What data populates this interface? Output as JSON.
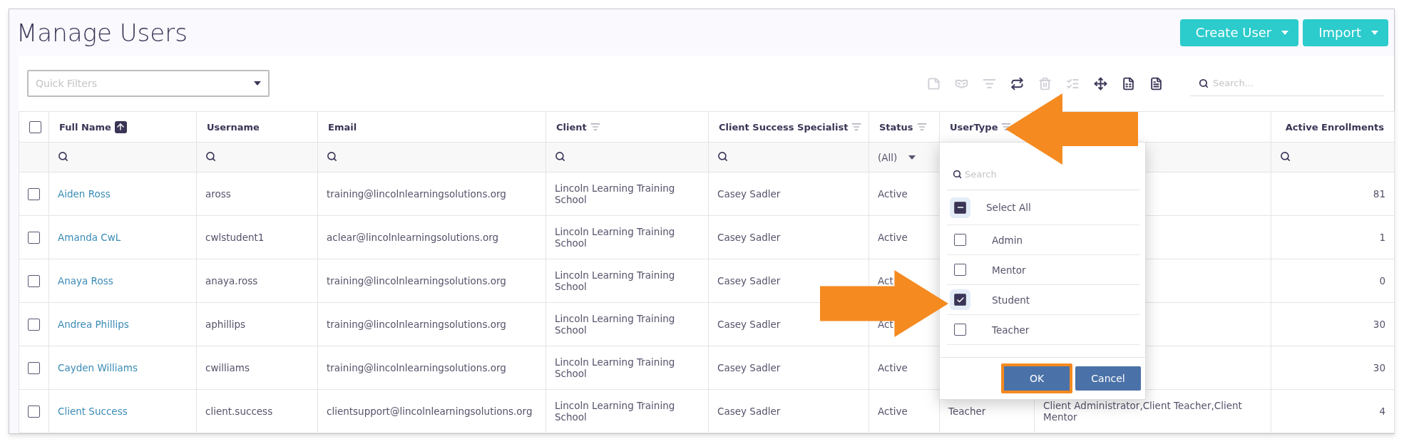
{
  "page": {
    "title": "Manage Users"
  },
  "header_buttons": [
    {
      "label": "Create User"
    },
    {
      "label": "Import"
    }
  ],
  "quick_filters": {
    "placeholder": "Quick Filters"
  },
  "toolbar": [
    {
      "kind": "note",
      "disabled": true
    },
    {
      "kind": "mask",
      "disabled": true
    },
    {
      "kind": "filter",
      "disabled": true
    },
    {
      "kind": "repeat",
      "disabled": false
    },
    {
      "kind": "trash",
      "disabled": true
    },
    {
      "kind": "checklist",
      "disabled": true
    },
    {
      "kind": "move",
      "disabled": false
    },
    {
      "kind": "spreadsheet",
      "disabled": false
    },
    {
      "kind": "document",
      "disabled": false
    }
  ],
  "search": {
    "placeholder": "Search..."
  },
  "table": {
    "select_all": {
      "checked": false
    },
    "columns": [
      {
        "label": "Full Name",
        "sorted": true,
        "filter_icon": false
      },
      {
        "label": "Username",
        "sorted": false,
        "filter_icon": false
      },
      {
        "label": "Email",
        "sorted": false,
        "filter_icon": false
      },
      {
        "label": "Client",
        "sorted": false,
        "filter_icon": true
      },
      {
        "label": "Client Success Specialist",
        "sorted": false,
        "filter_icon": true
      },
      {
        "label": "Status",
        "sorted": false,
        "filter_icon": true
      },
      {
        "label": "UserType",
        "sorted": false,
        "filter_icon": true
      },
      null,
      {
        "label": "Active Enrollments",
        "sorted": false,
        "filter_icon": false
      }
    ],
    "filter_row": [
      {
        "kind": "search"
      },
      {
        "kind": "search"
      },
      {
        "kind": "search"
      },
      {
        "kind": "search"
      },
      {
        "kind": "search"
      },
      {
        "kind": "dropdown",
        "value": "(All)"
      },
      {
        "kind": "none"
      },
      {
        "kind": "none"
      },
      {
        "kind": "search"
      }
    ],
    "rows": [
      {
        "checked": false,
        "cells": [
          "Aiden Ross",
          "aross",
          "training@lincolnlearningsolutions.org",
          "Lincoln Learning Training School",
          "Casey Sadler",
          "Active",
          null,
          null,
          "81"
        ]
      },
      {
        "checked": false,
        "cells": [
          "Amanda CwL",
          "cwlstudent1",
          "aclear@lincolnlearningsolutions.org",
          "Lincoln Learning Training School",
          "Casey Sadler",
          "Active",
          null,
          null,
          "1"
        ]
      },
      {
        "checked": false,
        "cells": [
          "Anaya Ross",
          "anaya.ross",
          "training@lincolnlearningsolutions.org",
          "Lincoln Learning Training School",
          "Casey Sadler",
          "Act",
          null,
          null,
          "0"
        ]
      },
      {
        "checked": false,
        "cells": [
          "Andrea Phillips",
          "aphillips",
          "training@lincolnlearningsolutions.org",
          "Lincoln Learning Training School",
          "Casey Sadler",
          "Act",
          null,
          null,
          "30"
        ]
      },
      {
        "checked": false,
        "cells": [
          "Cayden Williams",
          "cwilliams",
          "training@lincolnlearningsolutions.org",
          "Lincoln Learning Training School",
          "Casey Sadler",
          "Active",
          null,
          null,
          "30"
        ]
      },
      {
        "checked": false,
        "cells": [
          "Client Success",
          "client.success",
          "clientsupport@lincolnlearningsolutions.org",
          "Lincoln Learning Training School",
          "Casey Sadler",
          "Active",
          "Teacher",
          "Client Administrator,Client Teacher,Client Mentor",
          "4"
        ]
      }
    ]
  },
  "filter_popup": {
    "search_placeholder": "Search",
    "select_all": {
      "label": "Select All",
      "indeterminate": true
    },
    "options": [
      {
        "label": "Admin",
        "checked": false
      },
      {
        "label": "Mentor",
        "checked": false
      },
      {
        "label": "Student",
        "checked": true
      },
      {
        "label": "Teacher",
        "checked": false
      }
    ],
    "buttons": [
      {
        "label": "OK",
        "highlighted": true
      },
      {
        "label": "Cancel",
        "highlighted": false
      }
    ]
  },
  "annotations": [
    {
      "kind": "arrow-left"
    },
    {
      "kind": "arrow-right"
    }
  ]
}
